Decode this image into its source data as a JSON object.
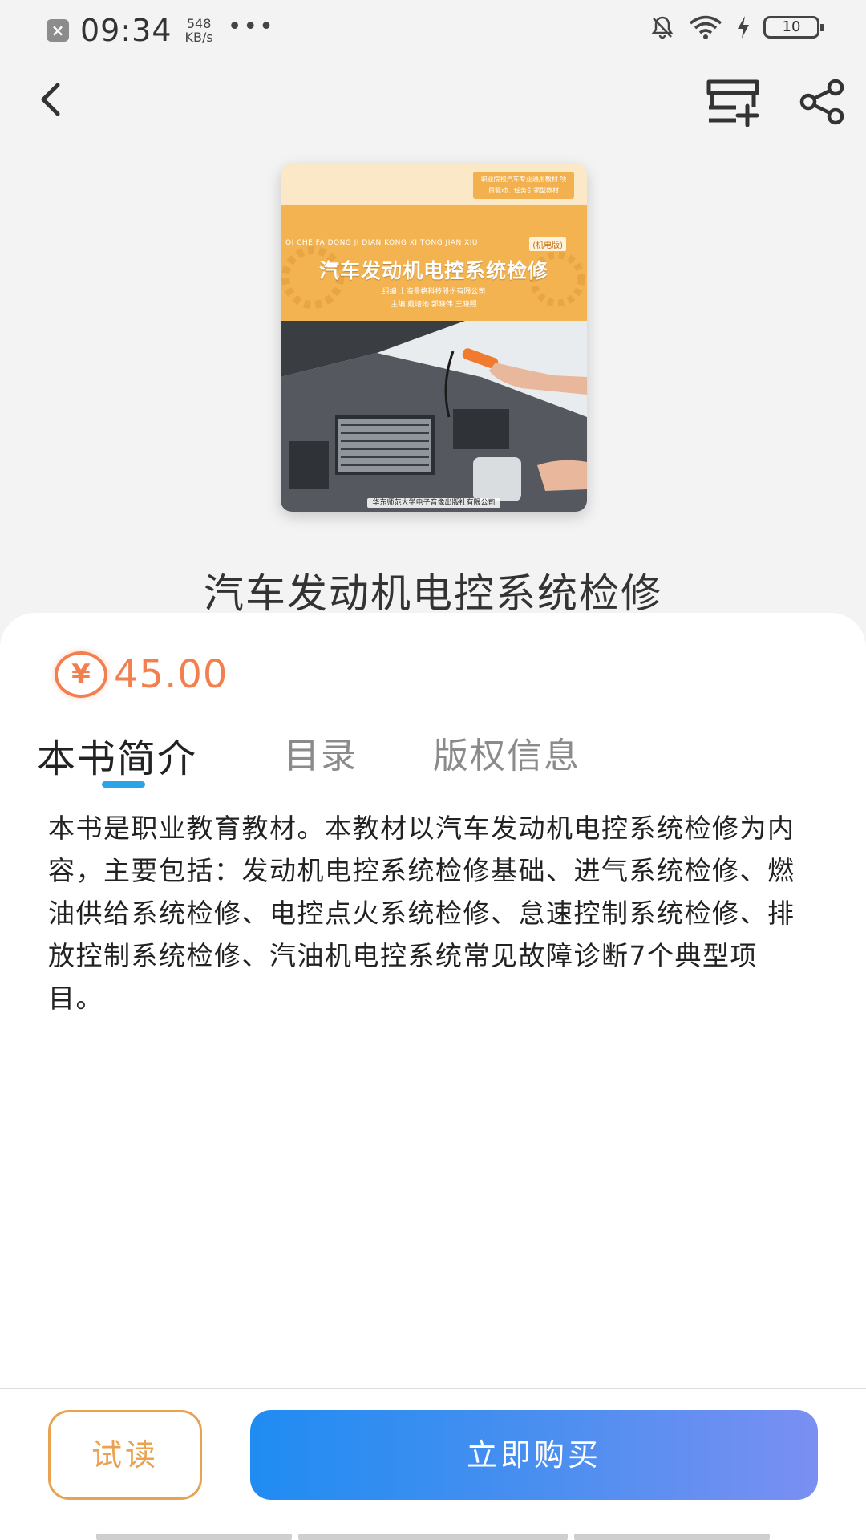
{
  "status_bar": {
    "close_glyph": "×",
    "time": "09:34",
    "net_speed_value": "548",
    "net_speed_unit": "KB/s",
    "more_glyph": "•••",
    "battery_level": "10"
  },
  "nav": {
    "back_icon": "chevron-left-icon",
    "add_list_icon": "add-to-list-icon",
    "share_icon": "share-icon"
  },
  "cover": {
    "tag": "职业院校汽车专业通用教材 项目驱动、任务引领型教材",
    "pinyin": "QI CHE FA DONG JI DIAN KONG XI TONG JIAN XIU",
    "edition": "(机电版)",
    "title": "汽车发动机电控系统检修",
    "subtitle1": "组编 上海景格科技股份有限公司",
    "subtitle2": "主编 戴培地 郭晓伟 王晓照",
    "publisher": "华东师范大学电子音像出版社有限公司"
  },
  "book": {
    "title": "汽车发动机电控系统检修",
    "currency_symbol": "¥",
    "price": "45.00"
  },
  "tabs": [
    {
      "label": "本书简介",
      "active": true
    },
    {
      "label": "目录",
      "active": false
    },
    {
      "label": "版权信息",
      "active": false
    }
  ],
  "description": "本书是职业教育教材。本教材以汽车发动机电控系统检修为内容，主要包括：发动机电控系统检修基础、进气系统检修、燃油供给系统检修、电控点火系统检修、怠速控制系统检修、排放控制系统检修、汽油机电控系统常见故障诊断7个典型项目。",
  "actions": {
    "trial_read": "试读",
    "buy_now": "立即购买"
  },
  "colors": {
    "accent_price": "#f47f4e",
    "tab_indicator": "#2aa4e6",
    "trial_border": "#e9a24f",
    "buy_gradient_start": "#1f8cf2",
    "buy_gradient_end": "#7b8ff2"
  }
}
